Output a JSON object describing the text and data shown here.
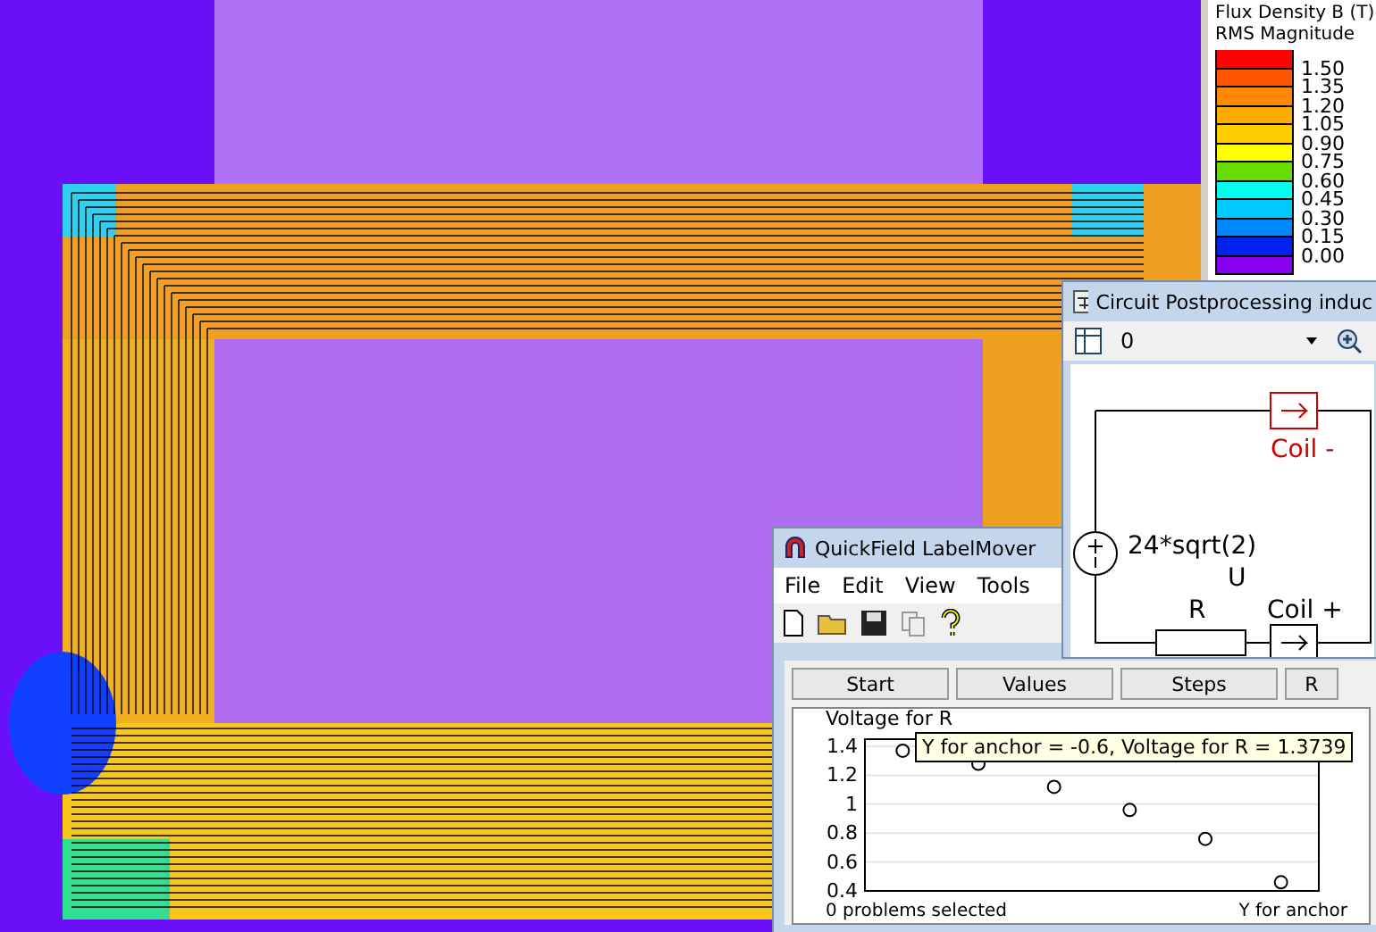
{
  "legend": {
    "title": "Flux Density B (T)",
    "subtitle": "RMS Magnitude",
    "bins": [
      {
        "color": "#ff0000",
        "label": "1.50"
      },
      {
        "color": "#ff5500",
        "label": "1.35"
      },
      {
        "color": "#ff8800",
        "label": "1.20"
      },
      {
        "color": "#ffaa00",
        "label": "1.05"
      },
      {
        "color": "#ffcc00",
        "label": "0.90"
      },
      {
        "color": "#ffff00",
        "label": "0.75"
      },
      {
        "color": "#66dd00",
        "label": "0.60"
      },
      {
        "color": "#00ffee",
        "label": "0.45"
      },
      {
        "color": "#00ccff",
        "label": "0.30"
      },
      {
        "color": "#0088ff",
        "label": "0.15"
      },
      {
        "color": "#0022ee",
        "label": "0.00"
      },
      {
        "color": "#8800ee"
      }
    ]
  },
  "circuit_window": {
    "title": "Circuit Postprocessing induc",
    "combo_value": "0",
    "coil_minus": "Coil -",
    "source_value": "24*sqrt(2)",
    "source_unit": "U",
    "resistor": "R",
    "coil_plus": "Coil +"
  },
  "labelmover": {
    "title": "QuickField LabelMover",
    "menu": [
      "File",
      "Edit",
      "View",
      "Tools"
    ],
    "tabs": [
      "Start",
      "Values",
      "Steps",
      "R"
    ],
    "chart_data": {
      "type": "scatter",
      "ylabel": "Voltage for R",
      "xlabel": "Y for anchor",
      "grid": true,
      "ylim": [
        0.4,
        1.45
      ],
      "yticks": [
        0.4,
        0.6,
        0.8,
        1,
        1.2,
        1.4
      ],
      "categories": [
        null,
        null,
        null,
        null,
        null,
        null
      ],
      "values": [
        1.37,
        1.28,
        1.12,
        0.96,
        0.76,
        0.46
      ]
    },
    "tooltip": "Y for anchor = -0.6, Voltage for R = 1.3739",
    "status": "0 problems selected"
  }
}
